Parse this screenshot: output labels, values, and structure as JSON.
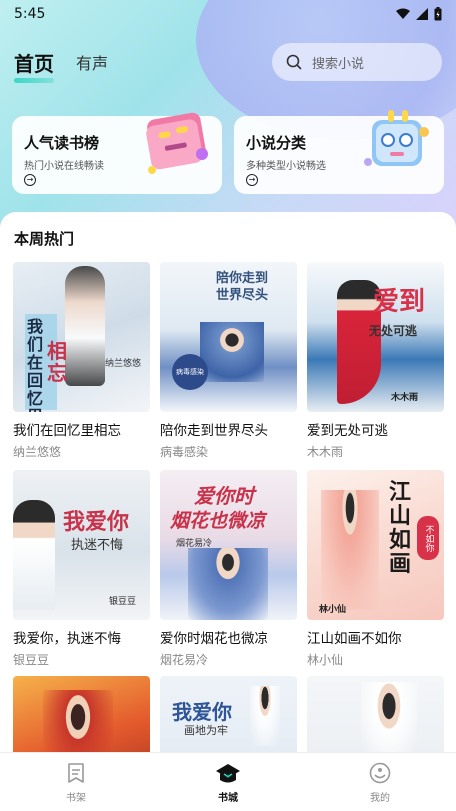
{
  "status": {
    "time": "5:45"
  },
  "header": {
    "tabs": [
      {
        "label": "首页",
        "active": true
      },
      {
        "label": "有声",
        "active": false
      }
    ],
    "search": {
      "placeholder": "搜索小说",
      "icon": "search-icon"
    }
  },
  "promos": [
    {
      "title": "人气读书榜",
      "subtitle": "热门小说在线畅读",
      "icon": "arrow-right-circle-icon"
    },
    {
      "title": "小说分类",
      "subtitle": "多种类型小说畅选",
      "icon": "arrow-right-circle-icon"
    }
  ],
  "section": {
    "title": "本周热门"
  },
  "books": [
    {
      "title": "我们在回忆里相忘",
      "author": "纳兰悠悠",
      "cover_text": [
        "我们",
        "在",
        "回",
        "忆",
        "里",
        "相",
        "忘"
      ],
      "cover_author": "纳兰悠悠"
    },
    {
      "title": "陪你走到世界尽头",
      "author": "病毒感染",
      "cover_text": [
        "陪你走到",
        "世界尽头"
      ],
      "cover_author": "病毒感染"
    },
    {
      "title": "爱到无处可逃",
      "author": "木木雨",
      "cover_text": [
        "爱到",
        "无处可逃"
      ],
      "cover_author": "木木雨"
    },
    {
      "title": "我爱你，执迷不悔",
      "author": "银豆豆",
      "cover_text": [
        "我爱你",
        "执迷不悔"
      ],
      "cover_author": "银豆豆"
    },
    {
      "title": "爱你时烟花也微凉",
      "author": "烟花易冷",
      "cover_text": [
        "爱你时",
        "烟花也微凉"
      ],
      "cover_author": "烟花易冷"
    },
    {
      "title": "江山如画不如你",
      "author": "林小仙",
      "cover_text": [
        "江",
        "山",
        "如",
        "画",
        "不如你"
      ],
      "cover_author": "林小仙"
    },
    {
      "title": "",
      "author": "",
      "cover_text": []
    },
    {
      "title": "",
      "author": "",
      "cover_text": [
        "我爱你",
        "画地为牢"
      ]
    },
    {
      "title": "",
      "author": "",
      "cover_text": []
    }
  ],
  "tabbar": [
    {
      "label": "书架",
      "icon": "bookshelf-icon",
      "active": false
    },
    {
      "label": "书城",
      "icon": "bookstore-icon",
      "active": true
    },
    {
      "label": "我的",
      "icon": "profile-icon",
      "active": false
    }
  ],
  "colors": {
    "accent": "#25d3c0",
    "red_text": "#d8314a",
    "dark": "#111111"
  }
}
